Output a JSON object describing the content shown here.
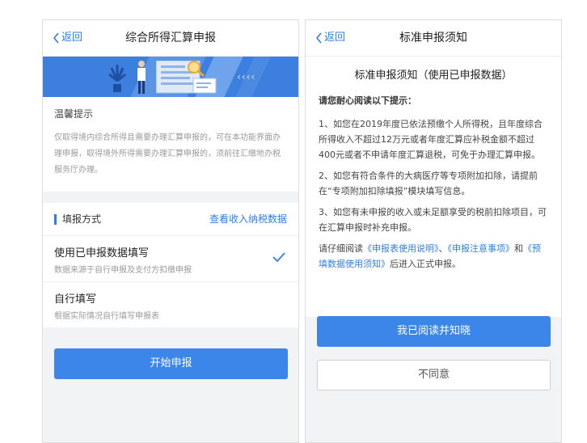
{
  "left": {
    "back_label": "返回",
    "title": "综合所得汇算申报",
    "banner_arrows": "‹‹‹‹",
    "tips_title": "温馨提示",
    "tips_text": "仅取得境内综合所得且需要办理汇算申报的，可在本功能界面办理申报，取得境外所得需要办理汇算申报的，须前往汇缴地办税服务厅办理。",
    "section_title": "填报方式",
    "section_link": "查看收入纳税数据",
    "options": [
      {
        "title": "使用已申报数据填写",
        "subtitle": "数据来源于自行申报及支付方扣缴申报",
        "selected": true
      },
      {
        "title": "自行填写",
        "subtitle": "根据实际情况自行填写申报表",
        "selected": false
      }
    ],
    "start_button": "开始申报"
  },
  "right": {
    "back_label": "返回",
    "title": "标准申报须知",
    "heading": "标准申报须知（使用已申报数据）",
    "subheading": "请您耐心阅读以下提示：",
    "para1": "1、如您在2019年度已依法预缴个人所得税，且年度综合所得收入不超过12万元或者年度汇算应补税金额不超过400元或者不申请年度汇算退税，可免于办理汇算申报。",
    "para2": "2、如您有符合条件的大病医疗等专项附加扣除，请提前在“专项附加扣除填报”模块填写信息。",
    "para3": "3、如您有未申报的收入或未足额享受的税前扣除项目，可在汇算申报时补充申报。",
    "para4_prefix": "请仔细阅读",
    "para4_link1": "《申报表使用说明》",
    "para4_sep1": "、",
    "para4_link2": "《申报注意事项》",
    "para4_and": "和",
    "para4_link3": "《预填数据使用须知》",
    "para4_suffix": "后进入正式申报。",
    "agree_button": "我已阅读并知晓",
    "disagree_button": "不同意"
  },
  "colors": {
    "accent": "#3b86e8",
    "link": "#2f7fe0",
    "banner": "#3d7fde"
  }
}
